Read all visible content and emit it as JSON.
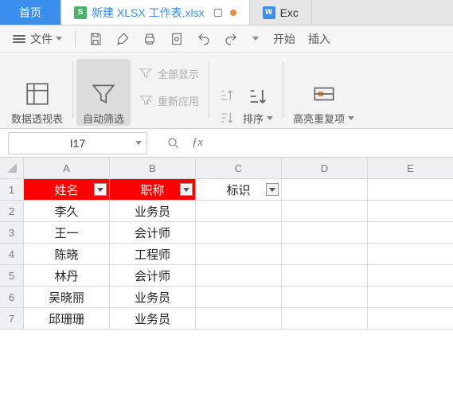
{
  "tabs": {
    "home": "首页",
    "active": {
      "icon_letter": "S",
      "title": "新建 XLSX 工作表.xlsx"
    },
    "next": {
      "icon_letter": "W",
      "title": "Exc"
    }
  },
  "toolbar1": {
    "file": "文件",
    "menu": {
      "start": "开始",
      "insert": "插入"
    }
  },
  "ribbon": {
    "pivot": "数据透视表",
    "autofilter": "自动筛选",
    "showall": "全部显示",
    "reapply": "重新应用",
    "sort": "排序",
    "highlight": "高亮重复项"
  },
  "formula_bar": {
    "cellref": "I17",
    "value": ""
  },
  "columns": [
    "A",
    "B",
    "C",
    "D",
    "E"
  ],
  "rows": [
    "1",
    "2",
    "3",
    "4",
    "5",
    "6",
    "7"
  ],
  "headers": {
    "a": "姓名",
    "b": "职称",
    "c": "标识"
  },
  "data": [
    {
      "a": "李久",
      "b": "业务员"
    },
    {
      "a": "王一",
      "b": "会计师"
    },
    {
      "a": "陈晓",
      "b": "工程师"
    },
    {
      "a": "林丹",
      "b": "会计师"
    },
    {
      "a": "吴晓丽",
      "b": "业务员"
    },
    {
      "a": "邱珊珊",
      "b": "业务员"
    }
  ]
}
